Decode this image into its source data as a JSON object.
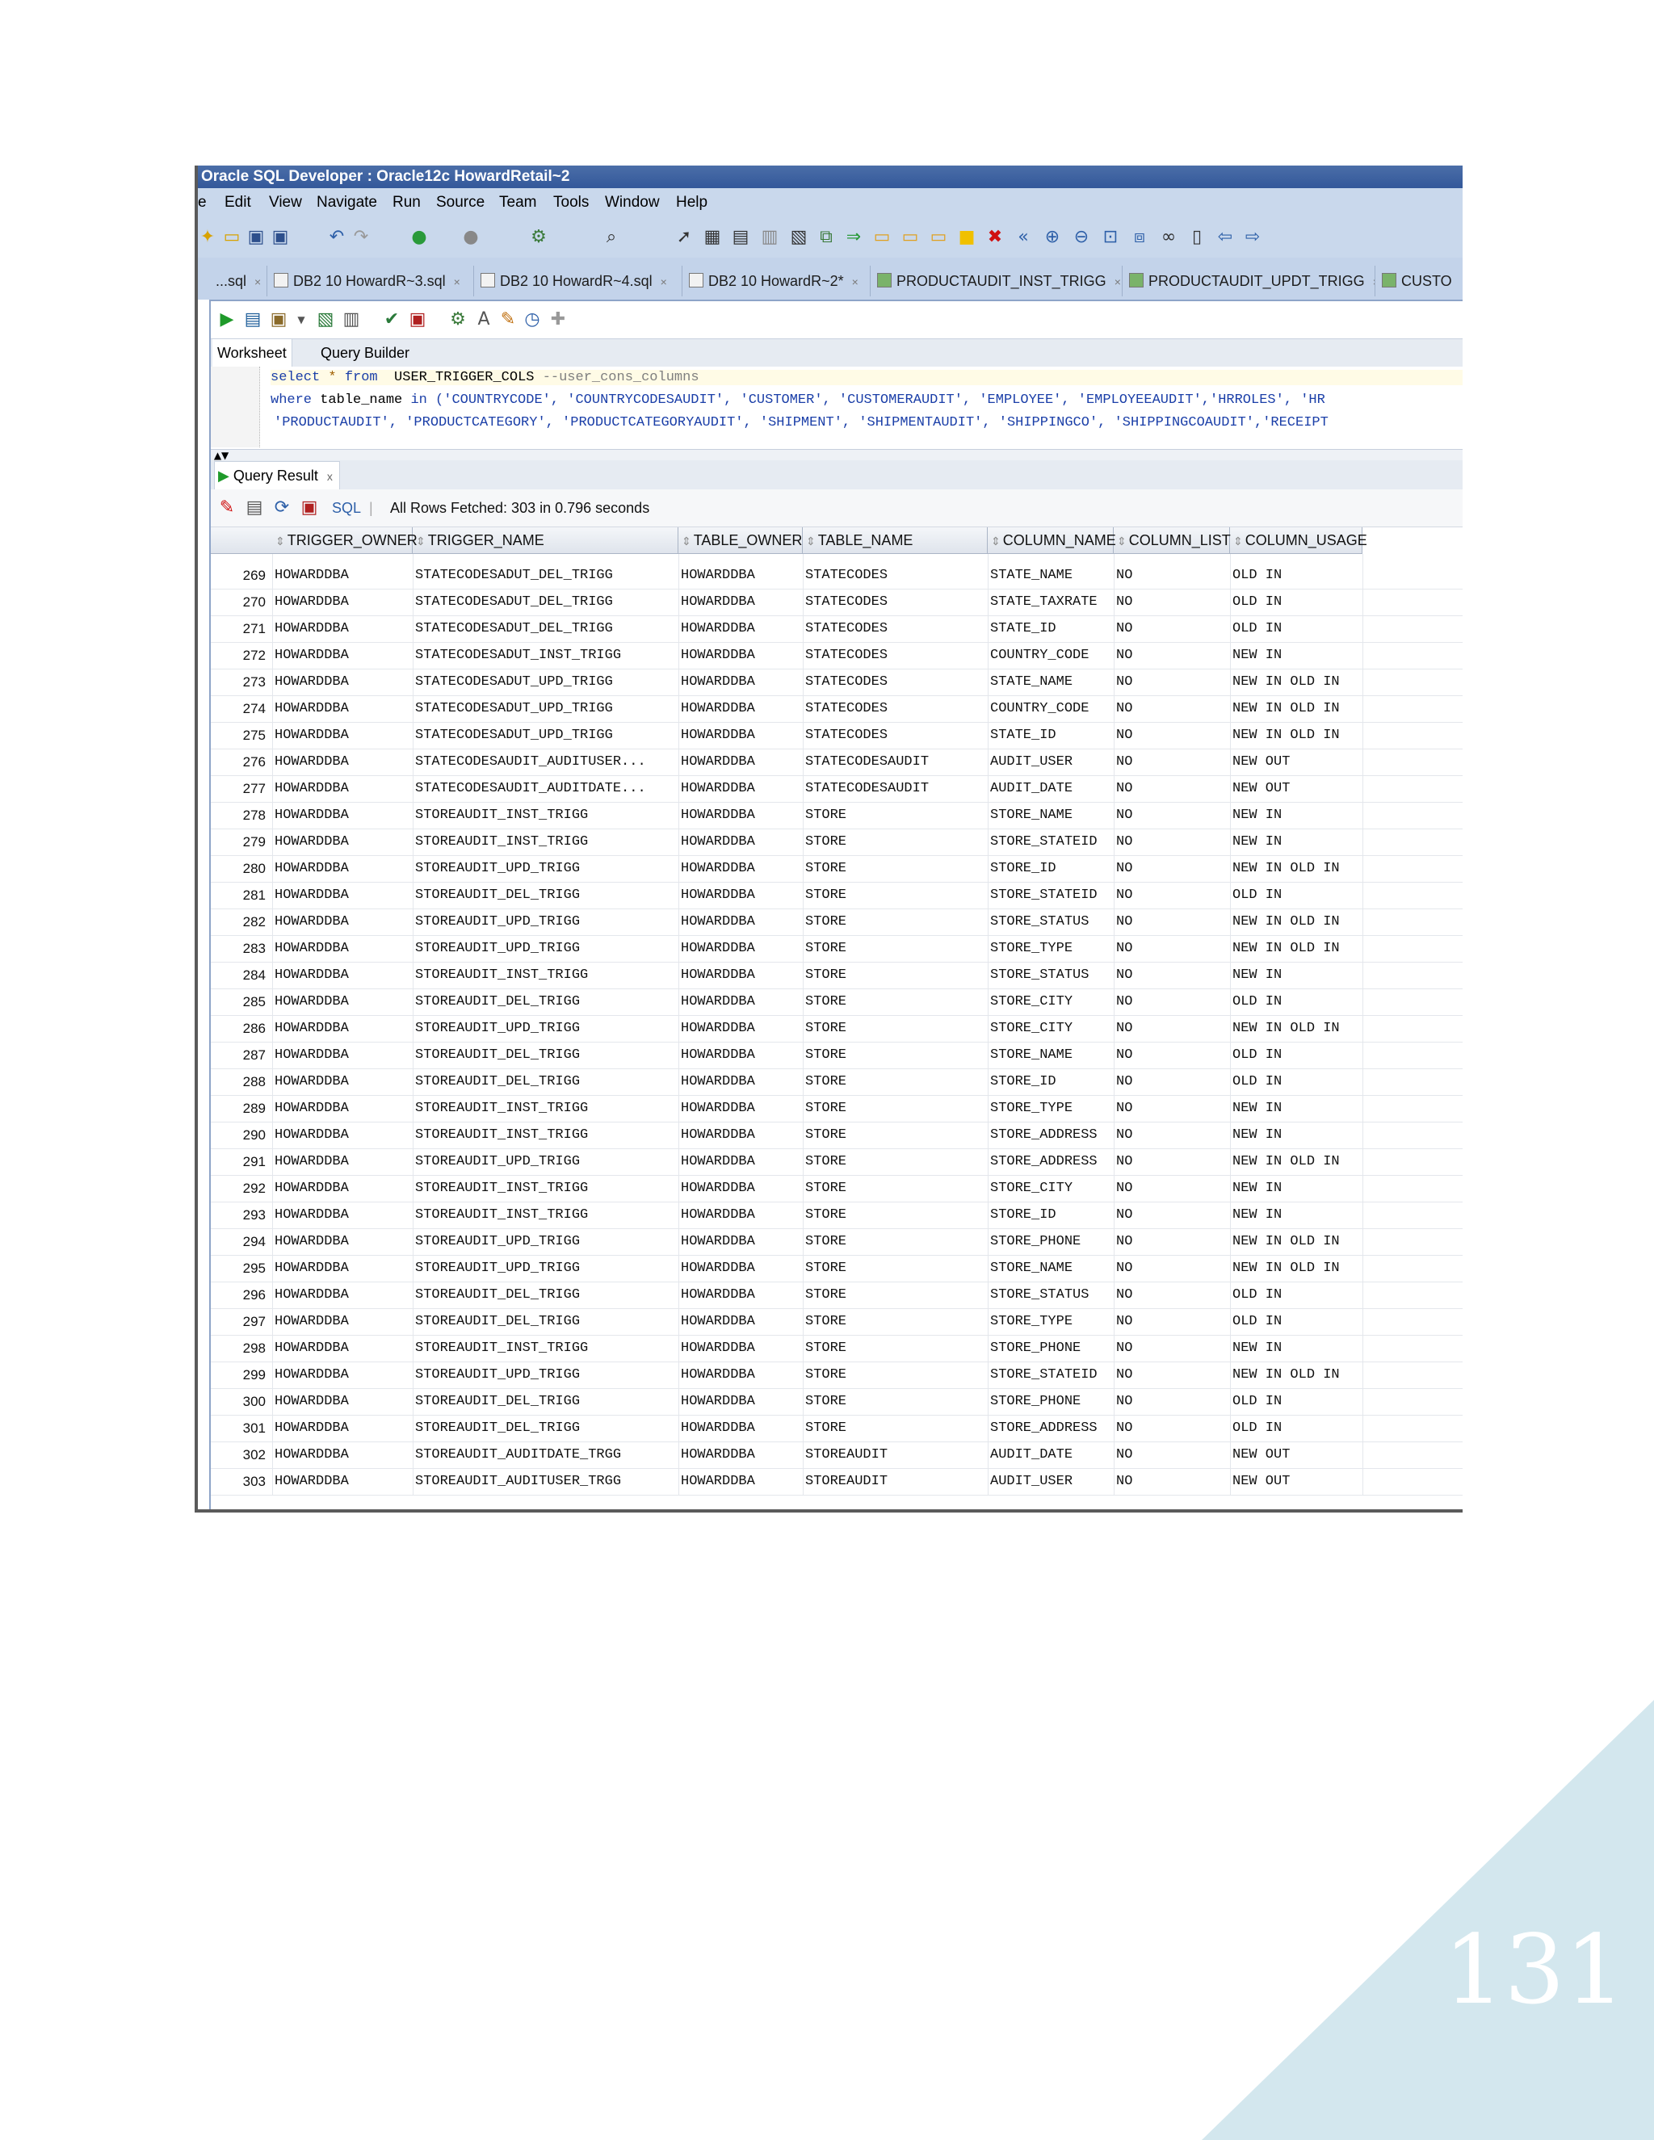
{
  "window": {
    "title": "Oracle SQL Developer : Oracle12c HowardRetail~2",
    "menu": [
      "e",
      "Edit",
      "View",
      "Navigate",
      "Run",
      "Source",
      "Team",
      "Tools",
      "Window",
      "Help"
    ]
  },
  "tabs": [
    {
      "label": "...sql"
    },
    {
      "label": "DB2 10 HowardR~3.sql"
    },
    {
      "label": "DB2 10 HowardR~4.sql"
    },
    {
      "label": "DB2 10 HowardR~2*"
    },
    {
      "label": "PRODUCTAUDIT_INST_TRIGG"
    },
    {
      "label": "PRODUCTAUDIT_UPDT_TRIGG"
    },
    {
      "label": "CUSTO"
    }
  ],
  "subtabs": {
    "worksheet": "Worksheet",
    "query_builder": "Query Builder"
  },
  "editor": {
    "line1": {
      "kw1": "select",
      "star": "*",
      "kw2": "from",
      "table": "USER_TRIGGER_COLS",
      "comment": "--user_cons_columns"
    },
    "line2": {
      "kw": "where",
      "text": " table_name ",
      "kw2": "in",
      "rest": " ('COUNTRYCODE', 'COUNTRYCODESAUDIT', 'CUSTOMER', 'CUSTOMERAUDIT', 'EMPLOYEE', 'EMPLOYEEAUDIT','HRROLES', 'HR"
    },
    "line3": "'PRODUCTAUDIT', 'PRODUCTCATEGORY', 'PRODUCTCATEGORYAUDIT', 'SHIPMENT', 'SHIPMENTAUDIT', 'SHIPPINGCO', 'SHIPPINGCOAUDIT','RECEIPT"
  },
  "results": {
    "tab_label": "Query Result",
    "tab_close": "x",
    "sql_link": "SQL",
    "status": "All Rows Fetched: 303 in 0.796 seconds",
    "columns": [
      "TRIGGER_OWNER",
      "TRIGGER_NAME",
      "TABLE_OWNER",
      "TABLE_NAME",
      "COLUMN_NAME",
      "COLUMN_LIST",
      "COLUMN_USAGE"
    ],
    "rows": [
      [
        "269",
        "HOWARDDBA",
        "STATECODESADUT_DEL_TRIGG",
        "HOWARDDBA",
        "STATECODES",
        "STATE_NAME",
        "NO",
        "OLD IN"
      ],
      [
        "270",
        "HOWARDDBA",
        "STATECODESADUT_DEL_TRIGG",
        "HOWARDDBA",
        "STATECODES",
        "STATE_TAXRATE",
        "NO",
        "OLD IN"
      ],
      [
        "271",
        "HOWARDDBA",
        "STATECODESADUT_DEL_TRIGG",
        "HOWARDDBA",
        "STATECODES",
        "STATE_ID",
        "NO",
        "OLD IN"
      ],
      [
        "272",
        "HOWARDDBA",
        "STATECODESADUT_INST_TRIGG",
        "HOWARDDBA",
        "STATECODES",
        "COUNTRY_CODE",
        "NO",
        "NEW IN"
      ],
      [
        "273",
        "HOWARDDBA",
        "STATECODESADUT_UPD_TRIGG",
        "HOWARDDBA",
        "STATECODES",
        "STATE_NAME",
        "NO",
        "NEW IN OLD IN"
      ],
      [
        "274",
        "HOWARDDBA",
        "STATECODESADUT_UPD_TRIGG",
        "HOWARDDBA",
        "STATECODES",
        "COUNTRY_CODE",
        "NO",
        "NEW IN OLD IN"
      ],
      [
        "275",
        "HOWARDDBA",
        "STATECODESADUT_UPD_TRIGG",
        "HOWARDDBA",
        "STATECODES",
        "STATE_ID",
        "NO",
        "NEW IN OLD IN"
      ],
      [
        "276",
        "HOWARDDBA",
        "STATECODESAUDIT_AUDITUSER...",
        "HOWARDDBA",
        "STATECODESAUDIT",
        "AUDIT_USER",
        "NO",
        "NEW OUT"
      ],
      [
        "277",
        "HOWARDDBA",
        "STATECODESAUDIT_AUDITDATE...",
        "HOWARDDBA",
        "STATECODESAUDIT",
        "AUDIT_DATE",
        "NO",
        "NEW OUT"
      ],
      [
        "278",
        "HOWARDDBA",
        "STOREAUDIT_INST_TRIGG",
        "HOWARDDBA",
        "STORE",
        "STORE_NAME",
        "NO",
        "NEW IN"
      ],
      [
        "279",
        "HOWARDDBA",
        "STOREAUDIT_INST_TRIGG",
        "HOWARDDBA",
        "STORE",
        "STORE_STATEID",
        "NO",
        "NEW IN"
      ],
      [
        "280",
        "HOWARDDBA",
        "STOREAUDIT_UPD_TRIGG",
        "HOWARDDBA",
        "STORE",
        "STORE_ID",
        "NO",
        "NEW IN OLD IN"
      ],
      [
        "281",
        "HOWARDDBA",
        "STOREAUDIT_DEL_TRIGG",
        "HOWARDDBA",
        "STORE",
        "STORE_STATEID",
        "NO",
        "OLD IN"
      ],
      [
        "282",
        "HOWARDDBA",
        "STOREAUDIT_UPD_TRIGG",
        "HOWARDDBA",
        "STORE",
        "STORE_STATUS",
        "NO",
        "NEW IN OLD IN"
      ],
      [
        "283",
        "HOWARDDBA",
        "STOREAUDIT_UPD_TRIGG",
        "HOWARDDBA",
        "STORE",
        "STORE_TYPE",
        "NO",
        "NEW IN OLD IN"
      ],
      [
        "284",
        "HOWARDDBA",
        "STOREAUDIT_INST_TRIGG",
        "HOWARDDBA",
        "STORE",
        "STORE_STATUS",
        "NO",
        "NEW IN"
      ],
      [
        "285",
        "HOWARDDBA",
        "STOREAUDIT_DEL_TRIGG",
        "HOWARDDBA",
        "STORE",
        "STORE_CITY",
        "NO",
        "OLD IN"
      ],
      [
        "286",
        "HOWARDDBA",
        "STOREAUDIT_UPD_TRIGG",
        "HOWARDDBA",
        "STORE",
        "STORE_CITY",
        "NO",
        "NEW IN OLD IN"
      ],
      [
        "287",
        "HOWARDDBA",
        "STOREAUDIT_DEL_TRIGG",
        "HOWARDDBA",
        "STORE",
        "STORE_NAME",
        "NO",
        "OLD IN"
      ],
      [
        "288",
        "HOWARDDBA",
        "STOREAUDIT_DEL_TRIGG",
        "HOWARDDBA",
        "STORE",
        "STORE_ID",
        "NO",
        "OLD IN"
      ],
      [
        "289",
        "HOWARDDBA",
        "STOREAUDIT_INST_TRIGG",
        "HOWARDDBA",
        "STORE",
        "STORE_TYPE",
        "NO",
        "NEW IN"
      ],
      [
        "290",
        "HOWARDDBA",
        "STOREAUDIT_INST_TRIGG",
        "HOWARDDBA",
        "STORE",
        "STORE_ADDRESS",
        "NO",
        "NEW IN"
      ],
      [
        "291",
        "HOWARDDBA",
        "STOREAUDIT_UPD_TRIGG",
        "HOWARDDBA",
        "STORE",
        "STORE_ADDRESS",
        "NO",
        "NEW IN OLD IN"
      ],
      [
        "292",
        "HOWARDDBA",
        "STOREAUDIT_INST_TRIGG",
        "HOWARDDBA",
        "STORE",
        "STORE_CITY",
        "NO",
        "NEW IN"
      ],
      [
        "293",
        "HOWARDDBA",
        "STOREAUDIT_INST_TRIGG",
        "HOWARDDBA",
        "STORE",
        "STORE_ID",
        "NO",
        "NEW IN"
      ],
      [
        "294",
        "HOWARDDBA",
        "STOREAUDIT_UPD_TRIGG",
        "HOWARDDBA",
        "STORE",
        "STORE_PHONE",
        "NO",
        "NEW IN OLD IN"
      ],
      [
        "295",
        "HOWARDDBA",
        "STOREAUDIT_UPD_TRIGG",
        "HOWARDDBA",
        "STORE",
        "STORE_NAME",
        "NO",
        "NEW IN OLD IN"
      ],
      [
        "296",
        "HOWARDDBA",
        "STOREAUDIT_DEL_TRIGG",
        "HOWARDDBA",
        "STORE",
        "STORE_STATUS",
        "NO",
        "OLD IN"
      ],
      [
        "297",
        "HOWARDDBA",
        "STOREAUDIT_DEL_TRIGG",
        "HOWARDDBA",
        "STORE",
        "STORE_TYPE",
        "NO",
        "OLD IN"
      ],
      [
        "298",
        "HOWARDDBA",
        "STOREAUDIT_INST_TRIGG",
        "HOWARDDBA",
        "STORE",
        "STORE_PHONE",
        "NO",
        "NEW IN"
      ],
      [
        "299",
        "HOWARDDBA",
        "STOREAUDIT_UPD_TRIGG",
        "HOWARDDBA",
        "STORE",
        "STORE_STATEID",
        "NO",
        "NEW IN OLD IN"
      ],
      [
        "300",
        "HOWARDDBA",
        "STOREAUDIT_DEL_TRIGG",
        "HOWARDDBA",
        "STORE",
        "STORE_PHONE",
        "NO",
        "OLD IN"
      ],
      [
        "301",
        "HOWARDDBA",
        "STOREAUDIT_DEL_TRIGG",
        "HOWARDDBA",
        "STORE",
        "STORE_ADDRESS",
        "NO",
        "OLD IN"
      ],
      [
        "302",
        "HOWARDDBA",
        "STOREAUDIT_AUDITDATE_TRGG",
        "HOWARDDBA",
        "STOREAUDIT",
        "AUDIT_DATE",
        "NO",
        "NEW OUT"
      ],
      [
        "303",
        "HOWARDDBA",
        "STOREAUDIT_AUDITUSER_TRGG",
        "HOWARDDBA",
        "STOREAUDIT",
        "AUDIT_USER",
        "NO",
        "NEW OUT"
      ]
    ]
  },
  "slide": {
    "page_number": "131"
  },
  "colors": {
    "title_bar": "#3b5fa0",
    "menu_bg": "#c9d8ec",
    "keyword": "#1b3fa8",
    "corner_triangle": "#d3e7ee"
  }
}
